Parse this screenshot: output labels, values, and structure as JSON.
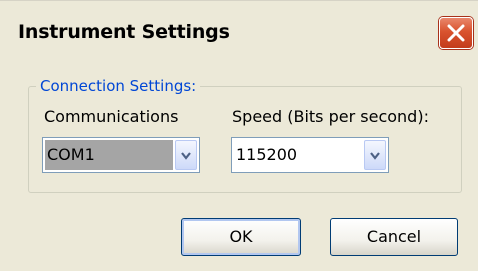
{
  "window": {
    "title": "Instrument Settings"
  },
  "icons": {
    "close": "close-icon",
    "dropdown": "chevron-down-icon"
  },
  "group": {
    "legend": "Connection Settings:",
    "communications": {
      "label": "Communications",
      "value": "COM1"
    },
    "speed": {
      "label": "Speed (Bits per second):",
      "value": "115200"
    }
  },
  "buttons": {
    "ok": "OK",
    "cancel": "Cancel"
  },
  "colors": {
    "legend": "#0046d5",
    "close": "#d9532e",
    "dialog_bg": "#ece9d8"
  }
}
